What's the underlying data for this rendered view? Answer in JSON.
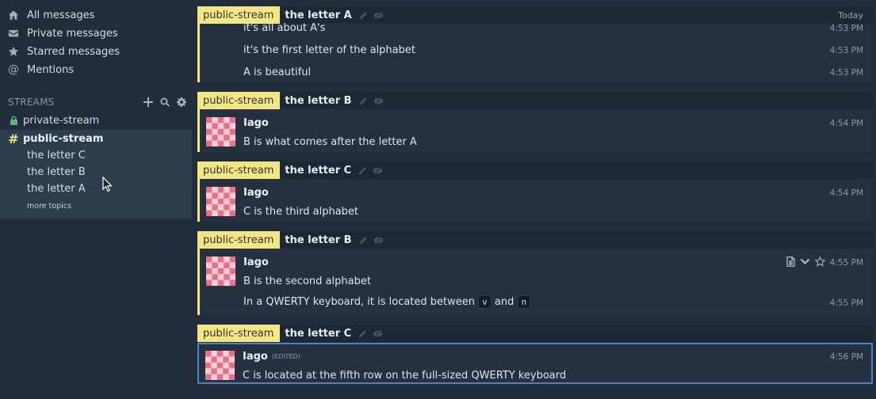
{
  "sidebar": {
    "nav": [
      {
        "label": "All messages",
        "icon": "home-icon"
      },
      {
        "label": "Private messages",
        "icon": "envelope-icon"
      },
      {
        "label": "Starred messages",
        "icon": "star-icon"
      },
      {
        "label": "Mentions",
        "icon": "at-icon"
      }
    ],
    "streams_header": "STREAMS",
    "streams": [
      {
        "name": "private-stream",
        "icon": "lock-icon"
      },
      {
        "name": "public-stream",
        "icon": "hash-icon"
      }
    ],
    "topics": [
      "the letter C",
      "the letter B",
      "the letter A"
    ],
    "more_topics": "more topics"
  },
  "feed": {
    "date_label": "Today",
    "recipients": [
      {
        "stream": "public-stream",
        "topic": "the letter A",
        "messages": [
          {
            "content": "it's all about A's",
            "time": "4:53 PM"
          },
          {
            "content": "it's the first letter of the alphabet",
            "time": "4:53 PM"
          },
          {
            "content": "A is beautiful",
            "time": "4:53 PM"
          }
        ]
      },
      {
        "stream": "public-stream",
        "topic": "the letter B",
        "messages": [
          {
            "sender": "Iago",
            "content": "B is what comes after the letter A",
            "time": "4:54 PM"
          }
        ]
      },
      {
        "stream": "public-stream",
        "topic": "the letter C",
        "messages": [
          {
            "sender": "Iago",
            "content": "C is the third alphabet",
            "time": "4:54 PM"
          }
        ]
      },
      {
        "stream": "public-stream",
        "topic": "the letter B",
        "messages": [
          {
            "sender": "Iago",
            "content": "B is the second alphabet",
            "time": "4:55 PM"
          },
          {
            "content_prefix": "In a QWERTY keyboard, it is located between",
            "code1": "v",
            "content_mid": "and",
            "code2": "n",
            "time": "4:55 PM"
          }
        ]
      },
      {
        "stream": "public-stream",
        "topic": "the letter C",
        "messages": [
          {
            "sender": "Iago",
            "edited": "(EDITED)",
            "content": "C is located at the fifth row on the full-sized QWERTY keyboard",
            "time": "4:56 PM"
          }
        ]
      }
    ]
  },
  "colors": {
    "stream_accent": "#f4e585",
    "selected_border": "#4b82c4",
    "background": "#212d3b"
  }
}
